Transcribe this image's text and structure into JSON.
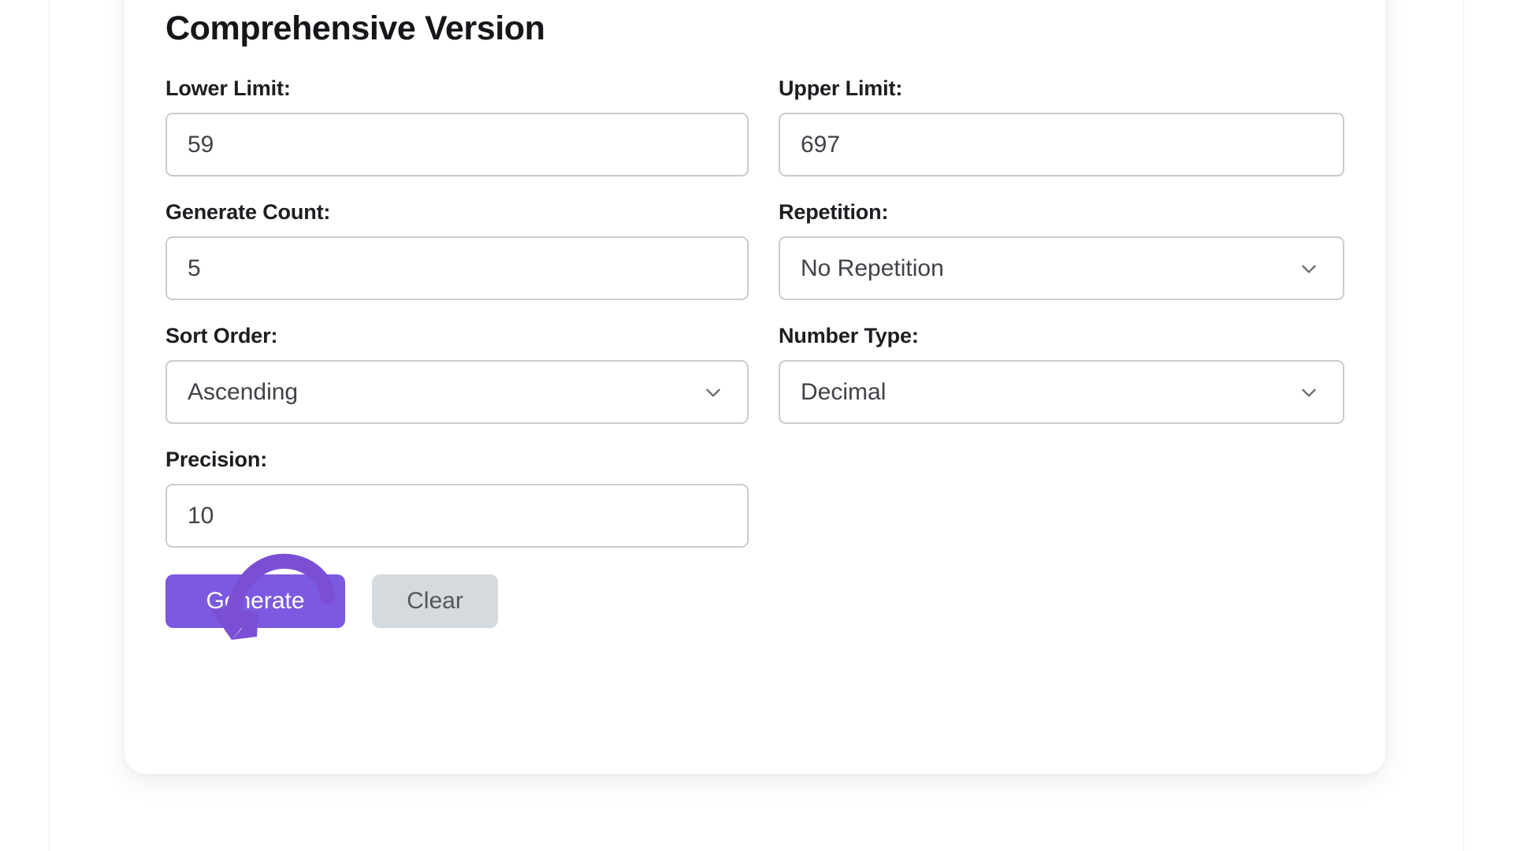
{
  "card": {
    "title": "Comprehensive Version"
  },
  "fields": [
    {
      "key": "lower_limit",
      "label": "Lower Limit:",
      "type": "text",
      "value": "59"
    },
    {
      "key": "upper_limit",
      "label": "Upper Limit:",
      "type": "text",
      "value": "697"
    },
    {
      "key": "generate_count",
      "label": "Generate Count:",
      "type": "text",
      "value": "5"
    },
    {
      "key": "repetition",
      "label": "Repetition:",
      "type": "select",
      "value": "No Repetition"
    },
    {
      "key": "sort_order",
      "label": "Sort Order:",
      "type": "select",
      "value": "Ascending"
    },
    {
      "key": "number_type",
      "label": "Number Type:",
      "type": "select",
      "value": "Decimal"
    },
    {
      "key": "precision",
      "label": "Precision:",
      "type": "text",
      "value": "10"
    }
  ],
  "buttons": {
    "generate": "Generate",
    "clear": "Clear"
  },
  "icons": {
    "chevron_down": "chevron-down-icon",
    "annotation_arrow": "curved-arrow-annotation-icon"
  },
  "colors": {
    "accent_purple": "#7c59e0",
    "annotation_purple": "#7b4fd4",
    "clear_button_bg": "#d4dade",
    "input_border": "#c7ccd1",
    "label_text": "#1d1d22",
    "value_text": "#3f4247",
    "card_bg": "#ffffff",
    "page_bg": "#ffffff"
  }
}
